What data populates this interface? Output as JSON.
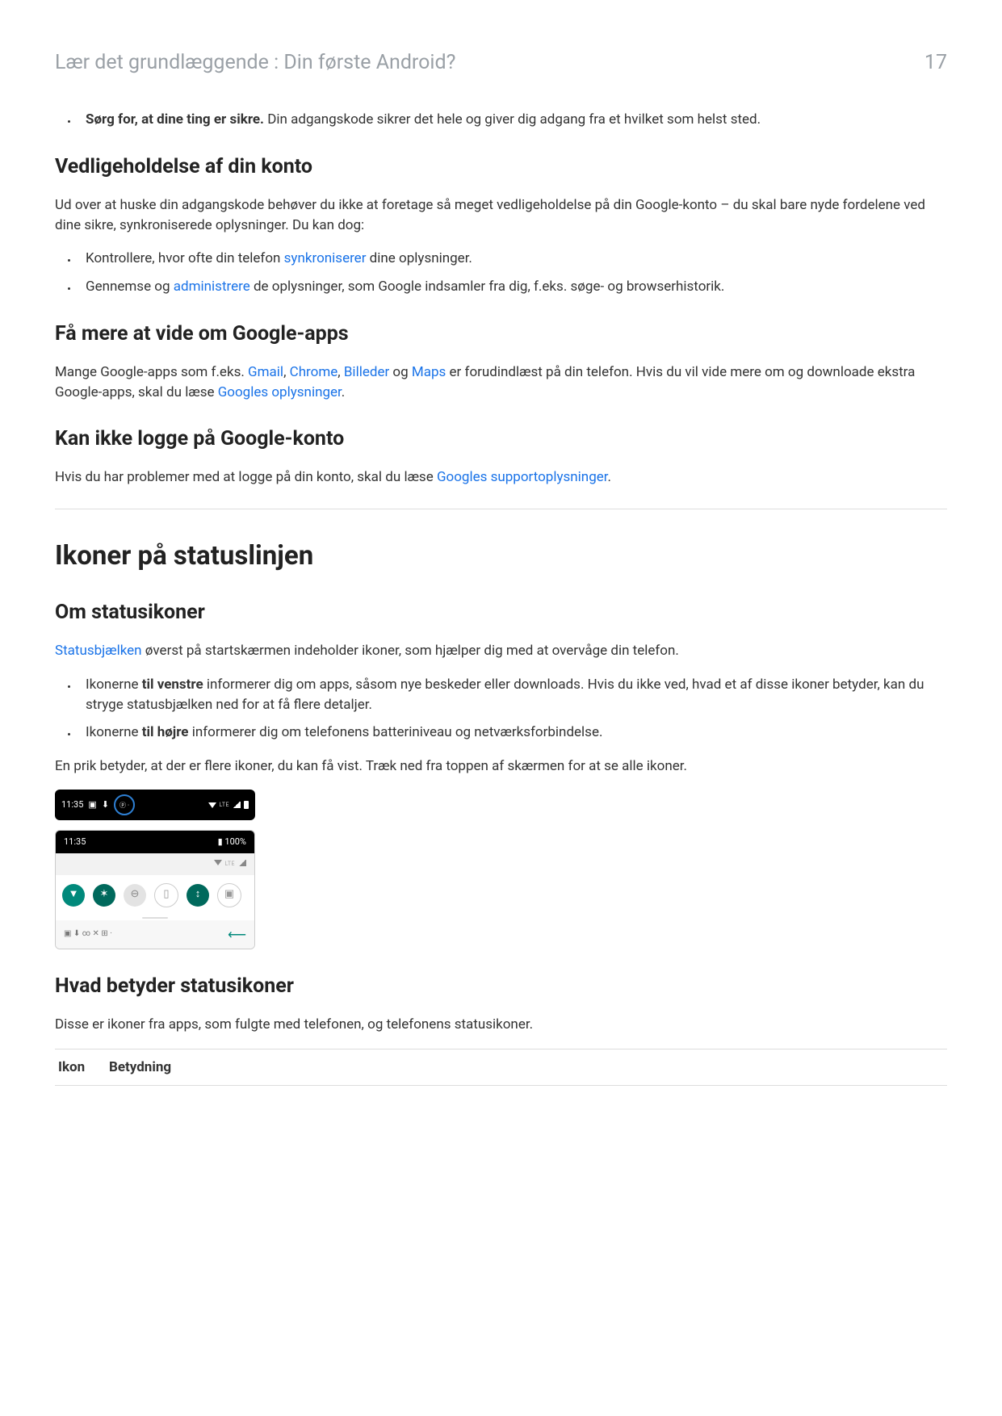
{
  "header": {
    "breadcrumb": "Lær det grundlæggende : Din første Android?",
    "page": "17"
  },
  "top_bullet": {
    "bold": "Sørg for, at dine ting er sikre.",
    "rest": " Din adgangskode sikrer det hele og giver dig adgang fra et hvilket som helst sted."
  },
  "maintain": {
    "h2": "Vedligeholdelse af din konto",
    "intro": "Ud over at huske din adgangskode behøver du ikke at foretage så meget vedligeholdelse på din Google-konto – du skal bare nyde fordelene ved dine sikre, synkroniserede oplysninger. Du kan dog:",
    "b1_pre": "Kontrollere, hvor ofte din telefon ",
    "b1_link": "synkroniserer",
    "b1_post": " dine oplysninger.",
    "b2_pre": "Gennemse og ",
    "b2_link": "administrere",
    "b2_post": " de oplysninger, som Google indsamler fra dig, f.eks. søge- og browserhistorik."
  },
  "apps": {
    "h2": "Få mere at vide om Google-apps",
    "pre": "Mange Google-apps som f.eks. ",
    "l1": "Gmail",
    "c1": ", ",
    "l2": "Chrome",
    "c2": ", ",
    "l3": "Billeder",
    "c3": " og ",
    "l4": "Maps",
    "mid": " er forudindlæst på din telefon. Hvis du vil vide mere om og downloade ekstra Google-apps, skal du læse ",
    "l5": "Googles oplysninger",
    "post": "."
  },
  "login": {
    "h2": "Kan ikke logge på Google-konto",
    "pre": "Hvis du har problemer med at logge på din konto, skal du læse ",
    "link": "Googles supportoplysninger",
    "post": "."
  },
  "statusline": {
    "h1": "Ikoner på statuslinjen"
  },
  "about": {
    "h2": "Om statusikoner",
    "intro_link": "Statusbjælken",
    "intro_post": " øverst på startskærmen indeholder ikoner, som hjælper dig med at overvåge din telefon.",
    "b1_pre": "Ikonerne ",
    "b1_bold": "til venstre",
    "b1_post": " informerer dig om apps, såsom nye beskeder eller downloads. Hvis du ikke ved, hvad et af disse ikoner betyder, kan du stryge statusbjælken ned for at få flere detaljer.",
    "b2_pre": "Ikonerne ",
    "b2_bold": "til højre",
    "b2_post": " informerer dig om telefonens batteriniveau og netværksforbindelse.",
    "dot_text": "En prik betyder, at der er flere ikoner, du kan få vist. Træk ned fra toppen af skærmen for at se alle ikoner."
  },
  "shots": {
    "time": "11:35",
    "battery": "100%",
    "lte": "LTE"
  },
  "meaning": {
    "h2": "Hvad betyder statusikoner",
    "intro": "Disse er ikoner fra apps, som fulgte med telefonen, og telefonens statusikoner."
  },
  "table": {
    "col1": "Ikon",
    "col2": "Betydning"
  }
}
